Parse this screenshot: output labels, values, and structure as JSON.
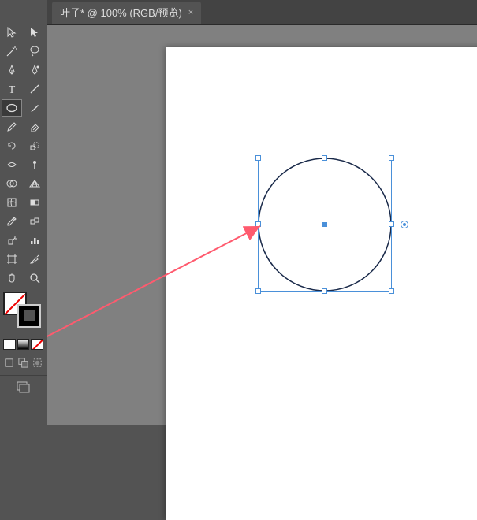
{
  "tab": {
    "title": "叶子* @ 100% (RGB/预览)",
    "close": "×"
  },
  "tools": [
    {
      "name": "selection-tool",
      "icon": "cursor-outline"
    },
    {
      "name": "direct-selection-tool",
      "icon": "cursor-solid"
    },
    {
      "name": "magic-wand-tool",
      "icon": "wand"
    },
    {
      "name": "lasso-tool",
      "icon": "lasso"
    },
    {
      "name": "pen-tool",
      "icon": "pen"
    },
    {
      "name": "curvature-tool",
      "icon": "curve-pen"
    },
    {
      "name": "type-tool",
      "icon": "text"
    },
    {
      "name": "line-segment-tool",
      "icon": "line"
    },
    {
      "name": "ellipse-tool",
      "icon": "ellipse",
      "selected": true
    },
    {
      "name": "paintbrush-tool",
      "icon": "brush"
    },
    {
      "name": "pencil-tool",
      "icon": "pencil"
    },
    {
      "name": "eraser-tool",
      "icon": "eraser"
    },
    {
      "name": "rotate-tool",
      "icon": "rotate"
    },
    {
      "name": "scale-tool",
      "icon": "scale"
    },
    {
      "name": "width-tool",
      "icon": "width"
    },
    {
      "name": "free-transform-tool",
      "icon": "pin"
    },
    {
      "name": "shape-builder-tool",
      "icon": "shape-builder"
    },
    {
      "name": "perspective-grid-tool",
      "icon": "perspective"
    },
    {
      "name": "mesh-tool",
      "icon": "mesh"
    },
    {
      "name": "gradient-tool",
      "icon": "gradient"
    },
    {
      "name": "eyedropper-tool",
      "icon": "eyedropper"
    },
    {
      "name": "blend-tool",
      "icon": "blend"
    },
    {
      "name": "symbol-sprayer-tool",
      "icon": "spray"
    },
    {
      "name": "column-graph-tool",
      "icon": "graph"
    },
    {
      "name": "artboard-tool",
      "icon": "artboard"
    },
    {
      "name": "slice-tool",
      "icon": "slice"
    },
    {
      "name": "hand-tool",
      "icon": "hand"
    },
    {
      "name": "zoom-tool",
      "icon": "zoom"
    }
  ],
  "colors": {
    "fill": "none",
    "stroke": "#000000"
  },
  "canvas": {
    "shape": "ellipse",
    "selected": true
  }
}
